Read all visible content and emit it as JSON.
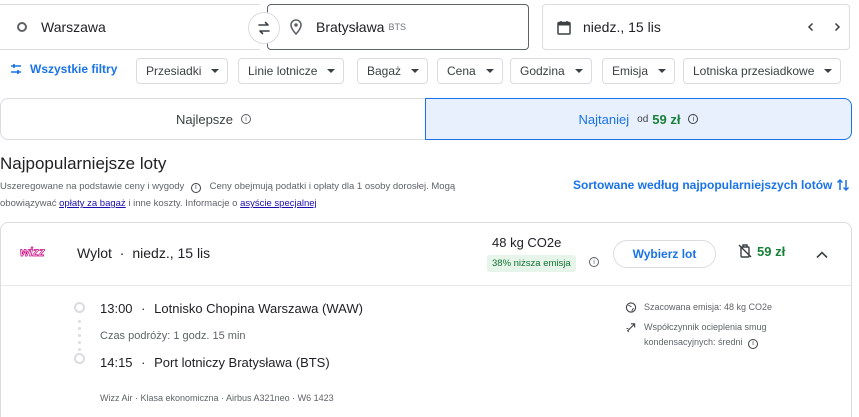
{
  "search": {
    "origin": "Warszawa",
    "destination": "Bratysława",
    "destination_code": "BTS",
    "date": "niedz., 15 lis"
  },
  "filters": {
    "all_filters": "Wszystkie filtry",
    "chips": [
      "Przesiadki",
      "Linie lotnicze",
      "Bagaż",
      "Cena",
      "Godzina",
      "Emisja",
      "Lotniska przesiadkowe"
    ]
  },
  "tabs": {
    "best": "Najlepsze",
    "cheapest": "Najtaniej",
    "cheapest_from": "od",
    "cheapest_price": "59 zł"
  },
  "section": {
    "title": "Najpopularniejsze loty",
    "desc_1": "Uszeregowane na podstawie ceny i wygody",
    "desc_2": "Ceny obejmują podatki i opłaty dla 1 osoby dorosłej. Mogą",
    "desc_3": "obowiązywać",
    "link_fees": "opłaty za bagaż",
    "desc_4": "i inne koszty. Informacje o",
    "link_special": "asyście specjalnej",
    "sort_label": "Sortowane według najpopularniejszych lotów"
  },
  "flight": {
    "airline_logo_text": "wizz",
    "direction": "Wylot",
    "date": "niedz., 15 lis",
    "co2": "48 kg CO2e",
    "co2_badge": "38% niższa emisja",
    "select_label": "Wybierz lot",
    "price": "59 zł",
    "dep_time": "13:00",
    "dep_airport": "Lotnisko Chopina Warszawa (WAW)",
    "duration": "Czas podróży: 1 godz. 15 min",
    "arr_time": "14:15",
    "arr_airport": "Port lotniczy Bratysława (BTS)",
    "details": "Wizz Air · Klasa ekonomiczna · Airbus A321neo · W6 1423",
    "emission_note": "Szacowana emisja: 48 kg CO2e",
    "contrail_note_1": "Współczynnik ocieplenia smug",
    "contrail_note_2": "kondensacyjnych: średni"
  },
  "colors": {
    "accent": "#1a73e8",
    "price_green": "#188038",
    "wizz_pink": "#c6007e"
  }
}
